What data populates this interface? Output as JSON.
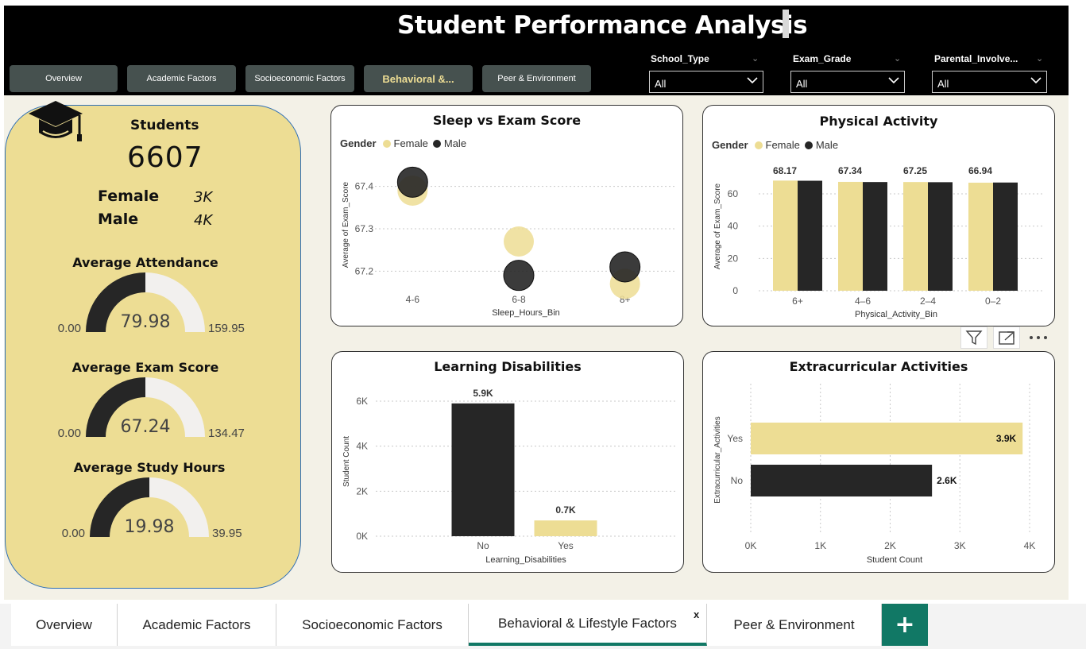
{
  "header": {
    "title": "Student Performance Analysis",
    "nav_buttons": [
      "Overview",
      "Academic Factors",
      "Socioeconomic Factors",
      "Behavioral &...",
      "Peer & Environment"
    ],
    "slicers": [
      {
        "label": "School_Type",
        "value": "All"
      },
      {
        "label": "Exam_Grade",
        "value": "All"
      },
      {
        "label": "Parental_Involve...",
        "value": "All"
      }
    ]
  },
  "kpi": {
    "students_label": "Students",
    "students_value": "6607",
    "female_label": "Female",
    "female_value": "3K",
    "male_label": "Male",
    "male_value": "4K",
    "gauges": [
      {
        "title": "Average Attendance",
        "min": "0.00",
        "value": "79.98",
        "max": "159.95",
        "fraction": 0.5
      },
      {
        "title": "Average Exam Score",
        "min": "0.00",
        "value": "67.24",
        "max": "134.47",
        "fraction": 0.5
      },
      {
        "title": "Average Study Hours",
        "min": "0.00",
        "value": "19.98",
        "max": "39.95",
        "fraction": 0.5
      }
    ]
  },
  "colors": {
    "female": "#eddd94",
    "male": "#262626",
    "accent": "#117865"
  },
  "legend": {
    "title": "Gender",
    "female": "Female",
    "male": "Male"
  },
  "chart_data": [
    {
      "type": "scatter",
      "title": "Sleep vs Exam Score",
      "xlabel": "Sleep_Hours_Bin",
      "ylabel": "Average of Exam_Score",
      "categories": [
        "4-6",
        "6-8",
        "8+"
      ],
      "yticks": [
        "67.2",
        "67.3",
        "67.4"
      ],
      "ylim": [
        67.15,
        67.45
      ],
      "series": [
        {
          "name": "Female",
          "values": [
            67.39,
            67.27,
            67.17
          ]
        },
        {
          "name": "Male",
          "values": [
            67.41,
            67.19,
            67.21
          ]
        }
      ]
    },
    {
      "type": "bar",
      "title": "Physical Activity",
      "xlabel": "Physical_Activity_Bin",
      "ylabel": "Average of Exam_Score",
      "categories": [
        "6+",
        "4–6",
        "2–4",
        "0–2"
      ],
      "yticks": [
        "0",
        "20",
        "40",
        "60"
      ],
      "ylim": [
        0,
        75
      ],
      "data_labels": [
        "68.17",
        "67.34",
        "67.25",
        "66.94"
      ],
      "series": [
        {
          "name": "Female",
          "values": [
            68.2,
            67.4,
            67.3,
            66.9
          ]
        },
        {
          "name": "Male",
          "values": [
            68.1,
            67.3,
            67.2,
            67.0
          ]
        }
      ]
    },
    {
      "type": "bar",
      "title": "Learning Disabilities",
      "xlabel": "Learning_Disabilities",
      "ylabel": "Student Count",
      "categories": [
        "No",
        "Yes"
      ],
      "yticks": [
        "0K",
        "2K",
        "4K",
        "6K"
      ],
      "ylim": [
        0,
        6500
      ],
      "values": [
        5900,
        700
      ],
      "data_labels": [
        "5.9K",
        "0.7K"
      ]
    },
    {
      "type": "bar",
      "title": "Extracurricular Activities",
      "xlabel": "Student Count",
      "ylabel": "Extracurricular_Activities",
      "categories": [
        "Yes",
        "No"
      ],
      "xticks": [
        "0K",
        "1K",
        "2K",
        "3K",
        "4K"
      ],
      "xlim": [
        0,
        4000
      ],
      "values": [
        3900,
        2600
      ],
      "data_labels": [
        "3.9K",
        "2.6K"
      ]
    }
  ],
  "tabs": [
    "Overview",
    "Academic Factors",
    "Socioeconomic Factors",
    "Behavioral & Lifestyle Factors",
    "Peer & Environment"
  ],
  "tab_close": "x",
  "add_tab": "+"
}
